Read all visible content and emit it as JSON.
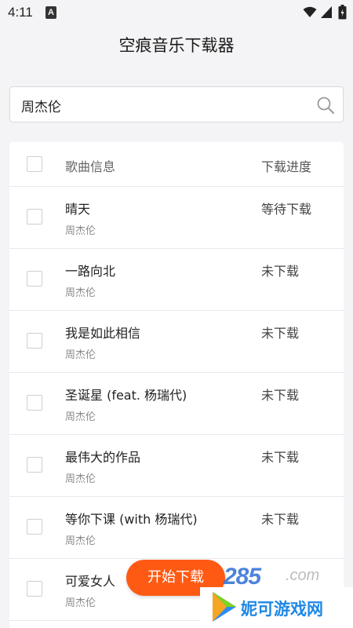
{
  "status_bar": {
    "time": "4:11",
    "notification_letter": "A",
    "icons": [
      "wifi-icon",
      "signal-icon",
      "battery-icon"
    ]
  },
  "app": {
    "title": "空痕音乐下载器"
  },
  "search": {
    "value": "周杰伦",
    "icon": "search-icon"
  },
  "table": {
    "header": {
      "info_label": "歌曲信息",
      "progress_label": "下载进度"
    },
    "rows": [
      {
        "title": "晴天",
        "artist": "周杰伦",
        "status": "等待下载"
      },
      {
        "title": "一路向北",
        "artist": "周杰伦",
        "status": "未下载"
      },
      {
        "title": "我是如此相信",
        "artist": "周杰伦",
        "status": "未下载"
      },
      {
        "title": "圣诞星 (feat. 杨瑞代)",
        "artist": "周杰伦",
        "status": "未下载"
      },
      {
        "title": "最伟大的作品",
        "artist": "周杰伦",
        "status": "未下载"
      },
      {
        "title": "等你下课 (with 杨瑞代)",
        "artist": "周杰伦",
        "status": "未下载"
      },
      {
        "title": "可爱女人",
        "artist": "周杰伦",
        "status": ""
      }
    ]
  },
  "actions": {
    "start_download_label": "开始下载"
  },
  "watermark": {
    "number": "285",
    "suffix": ".com",
    "site_name": "妮可游戏网"
  },
  "colors": {
    "accent": "#ff5a14",
    "background": "#f4f4f6",
    "watermark_blue": "#1e88e5"
  }
}
